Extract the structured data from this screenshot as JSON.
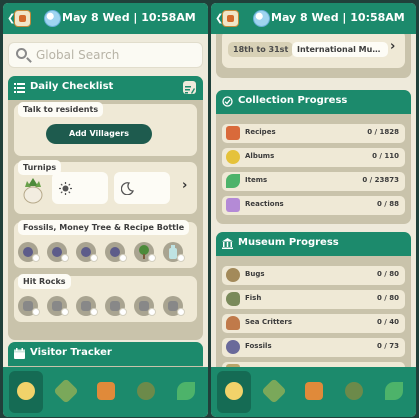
{
  "status": {
    "date_text": "May 8 Wed | 10:58AM",
    "back_icon": "back-arrow-icon",
    "app_icon": "nookphone-app-icon",
    "weather_icon": "sunny-weather-icon"
  },
  "left": {
    "search": {
      "placeholder": "Global Search"
    },
    "checklist": {
      "title": "Daily Checklist",
      "talk_label": "Talk to residents",
      "add_villagers_label": "Add Villagers",
      "turnips_label": "Turnips",
      "fossils_label": "Fossils, Money Tree & Recipe Bottle",
      "hit_rocks_label": "Hit Rocks"
    },
    "visitor_tracker": {
      "title": "Visitor Tracker"
    }
  },
  "right": {
    "dates": {
      "range_label": "18th to 31st",
      "location_label": "International Museum..."
    },
    "collection": {
      "title": "Collection Progress",
      "rows": [
        {
          "label": "Recipes",
          "count": "0 / 1828",
          "icon": "recipe-icon"
        },
        {
          "label": "Albums",
          "count": "0 / 110",
          "icon": "music-note-icon"
        },
        {
          "label": "Items",
          "count": "0 / 23873",
          "icon": "leaf-icon"
        },
        {
          "label": "Reactions",
          "count": "0 / 88",
          "icon": "reaction-icon"
        }
      ]
    },
    "museum": {
      "title": "Museum Progress",
      "rows": [
        {
          "label": "Bugs",
          "count": "0 / 80",
          "icon": "bug-icon"
        },
        {
          "label": "Fish",
          "count": "0 / 80",
          "icon": "fish-icon"
        },
        {
          "label": "Sea Critters",
          "count": "0 / 40",
          "icon": "octopus-icon"
        },
        {
          "label": "Fossils",
          "count": "0 / 73",
          "icon": "fossil-icon"
        }
      ]
    }
  },
  "navbar": {
    "items": [
      {
        "name": "home",
        "icon": "isabelle-icon"
      },
      {
        "name": "critterpedia",
        "icon": "bug-net-icon"
      },
      {
        "name": "catalog",
        "icon": "catalog-icon"
      },
      {
        "name": "villagers",
        "icon": "villager-icon"
      },
      {
        "name": "items",
        "icon": "leaf-icon"
      }
    ]
  },
  "colors": {
    "accent": "#1c8a6c",
    "panel": "#c9c3ab",
    "card": "#efe9d6",
    "button": "#1e5b4e"
  }
}
